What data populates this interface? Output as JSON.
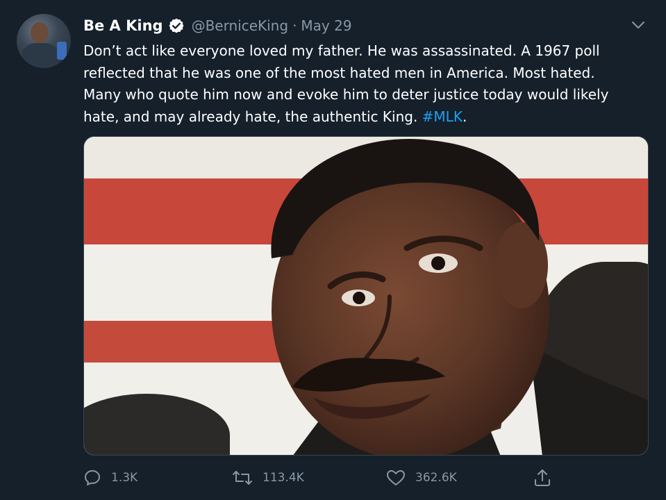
{
  "author": {
    "name": "Be A King",
    "handle": "@BerniceKing",
    "separator": "·",
    "date": "May 29",
    "verified": true
  },
  "tweet": {
    "text": "Don’t act like everyone loved my father. He was assassinated. A 1967 poll\nreflected that he was one of the most hated men in America. Most hated.\nMany who quote him now and evoke him to deter justice today would likely\nhate, and may already hate, the authentic King. ",
    "hashtag": "#MLK",
    "trailing": "."
  },
  "actions": {
    "replies": "1.3K",
    "retweets": "113.4K",
    "likes": "362.6K"
  },
  "icons": {
    "verified": "verified-badge-icon",
    "caret": "chevron-down-icon",
    "reply": "reply-icon",
    "retweet": "retweet-icon",
    "like": "heart-icon",
    "share": "share-icon"
  },
  "colors": {
    "background": "#15202b",
    "text": "#ffffff",
    "muted": "#8899a6",
    "link": "#1da1f2",
    "border": "#38444d"
  }
}
